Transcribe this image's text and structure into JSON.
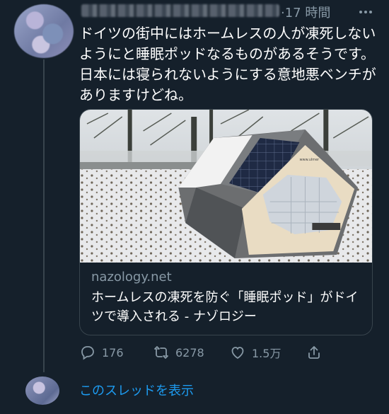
{
  "header": {
    "timestamp": "·17 時間"
  },
  "tweet": {
    "text": "ドイツの街中にはホームレスの人が凍死しないようにと睡眠ポッドなるものがあるそうです。日本には寝られないようにする意地悪ベンチがありますけどね。"
  },
  "card": {
    "domain": "nazology.net",
    "title": "ホームレスの凍死を防ぐ「睡眠ポッド」がドイツで導入される - ナゾロジー"
  },
  "actions": {
    "replies": "176",
    "retweets": "6278",
    "likes": "1.5万"
  },
  "thread": {
    "show_label": "このスレッドを表示"
  },
  "icons": {
    "reply": "reply-icon",
    "retweet": "retweet-icon",
    "like": "heart-icon",
    "share": "share-icon",
    "more": "more-icon"
  },
  "colors": {
    "background": "#15202b",
    "secondary_text": "#8899a6",
    "link": "#1d9bf0",
    "border": "#38444d"
  }
}
